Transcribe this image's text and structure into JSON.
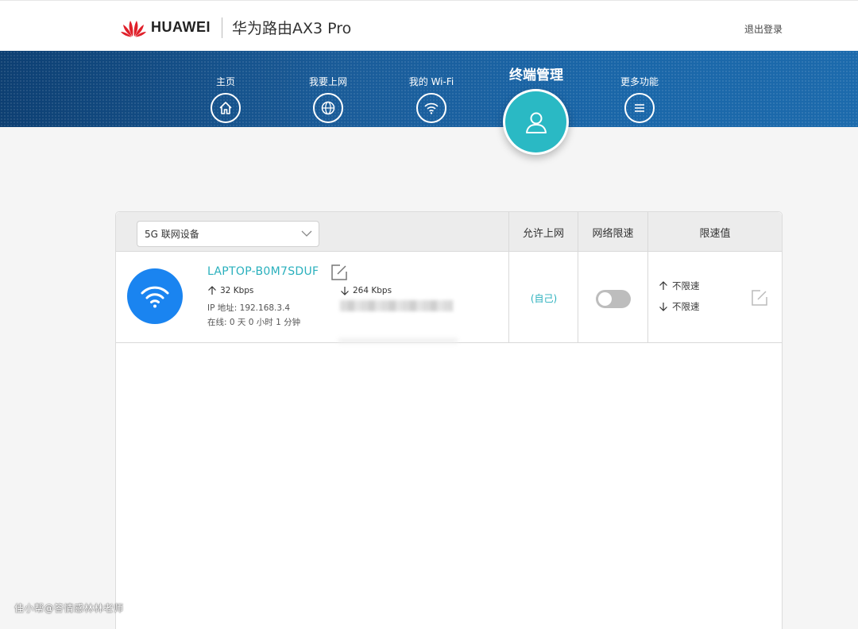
{
  "header": {
    "brand": "HUAWEI",
    "product": "华为路由AX3 Pro",
    "logout": "退出登录",
    "logo_color": "#e0202a"
  },
  "nav": {
    "items": [
      {
        "label": "主页",
        "icon": "home-icon"
      },
      {
        "label": "我要上网",
        "icon": "globe-icon"
      },
      {
        "label": "我的 Wi-Fi",
        "icon": "wifi-icon"
      },
      {
        "label": "终端管理",
        "icon": "user-icon",
        "active": true
      },
      {
        "label": "更多功能",
        "icon": "menu-icon"
      }
    ],
    "active_color": "#2ab9c4"
  },
  "table": {
    "filter": "5G 联网设备",
    "headers": [
      "允许上网",
      "网络限速",
      "限速值"
    ],
    "devices": [
      {
        "name": "LAPTOP-B0M7SDUF",
        "upload": "32 Kbps",
        "download": "264 Kbps",
        "ip": "IP 地址: 192.168.3.4",
        "online": "在线: 0 天 0 小时 1 分钟",
        "access": "(自己)",
        "limit_enabled": false,
        "limit_up": "不限速",
        "limit_down": "不限速"
      }
    ]
  },
  "watermark": "佳小帮@答情感林林老师"
}
